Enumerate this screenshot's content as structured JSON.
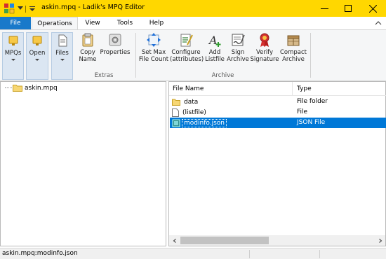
{
  "window": {
    "title": "askin.mpq - Ladik's MPQ Editor",
    "minimize_glyph": "—",
    "maximize_glyph": "☐",
    "close_glyph": "✕"
  },
  "ribbon_tabs": [
    {
      "label": "File"
    },
    {
      "label": "Operations"
    },
    {
      "label": "View"
    },
    {
      "label": "Tools"
    },
    {
      "label": "Help"
    }
  ],
  "ribbon": {
    "buttons": {
      "mpqs": {
        "label": "MPQs"
      },
      "open": {
        "label": "Open"
      },
      "files": {
        "label": "Files"
      },
      "copy_name": {
        "label_1": "Copy",
        "label_2": "Name"
      },
      "properties": {
        "label": "Properties"
      },
      "set_max": {
        "label_1": "Set Max",
        "label_2": "File Count"
      },
      "configure": {
        "label_1": "Configure",
        "label_2": "(attributes)"
      },
      "add_listfile": {
        "label_1": "Add",
        "label_2": "Listfile"
      },
      "sign_archive": {
        "label_1": "Sign",
        "label_2": "Archive"
      },
      "verify_signature": {
        "label_1": "Verify",
        "label_2": "Signature"
      },
      "compact_archive": {
        "label_1": "Compact",
        "label_2": "Archive"
      }
    },
    "groups": {
      "extras": "Extras",
      "archive": "Archive"
    }
  },
  "tree": {
    "root_label": "askin.mpq"
  },
  "file_list": {
    "columns": {
      "name": "File Name",
      "type": "Type"
    },
    "rows": [
      {
        "name": "data",
        "type": "File folder",
        "icon": "folder-icon"
      },
      {
        "name": "(listfile)",
        "type": "File",
        "icon": "file-icon"
      },
      {
        "name": "modinfo.json",
        "type": "JSON File",
        "icon": "json-file-icon",
        "selected": true
      }
    ]
  },
  "status_bar": {
    "text": "askin.mpq:modinfo.json"
  },
  "colors": {
    "titlebar": "#ffd700",
    "file_tab": "#1979ca",
    "selection": "#0078d7"
  }
}
